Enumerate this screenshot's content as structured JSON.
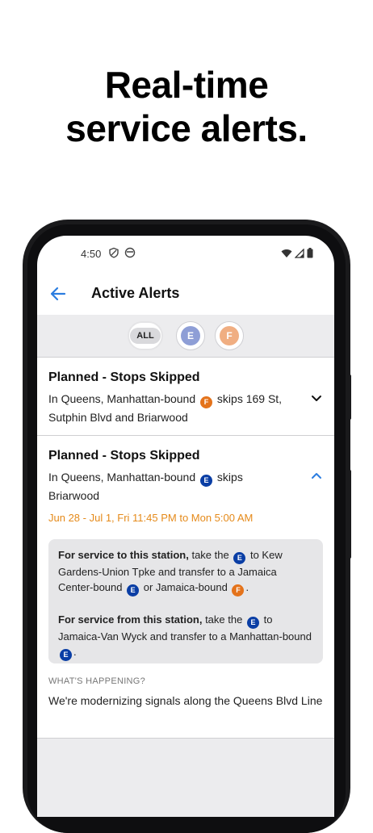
{
  "headline": {
    "line1": "Real-time",
    "line2": "service alerts."
  },
  "status_bar": {
    "time": "4:50"
  },
  "app_bar": {
    "title": "Active Alerts"
  },
  "filters": {
    "all_label": "ALL",
    "line_e": "E",
    "line_f": "F"
  },
  "colors": {
    "e_line": "#0a3ea5",
    "f_line": "#e4731b",
    "accent": "#2b7de0"
  },
  "alerts": [
    {
      "title": "Planned - Stops Skipped",
      "body_pre": "In Queens, Manhattan-bound",
      "line": "F",
      "body_post": "skips 169 St, Sutphin Blvd and Briarwood",
      "expanded": false
    },
    {
      "title": "Planned - Stops Skipped",
      "body_pre": "In Queens, Manhattan-bound",
      "line": "E",
      "body_post": "skips Briarwood",
      "expanded": true,
      "dates": "Jun 28 - Jul 1, Fri 11:45 PM to Mon 5:00 AM",
      "to_station": {
        "lead": "For service to this station,",
        "t1": "take the",
        "line1": "E",
        "t2": "to Kew Gardens-Union Tpke and transfer to a Jamaica Center-bound",
        "line2": "E",
        "t3": "or Jamaica-bound",
        "line3": "F",
        "t4": "."
      },
      "from_station": {
        "lead": "For service from this station,",
        "t1": "take the",
        "line1": "E",
        "t2": "to Jamaica-Van Wyck and transfer to a Manhattan-bound",
        "line2": "E",
        "t3": "."
      },
      "whats_happening_label": "WHAT'S HAPPENING?",
      "whats_happening_text": "We're modernizing signals along the Queens Blvd Line"
    }
  ]
}
